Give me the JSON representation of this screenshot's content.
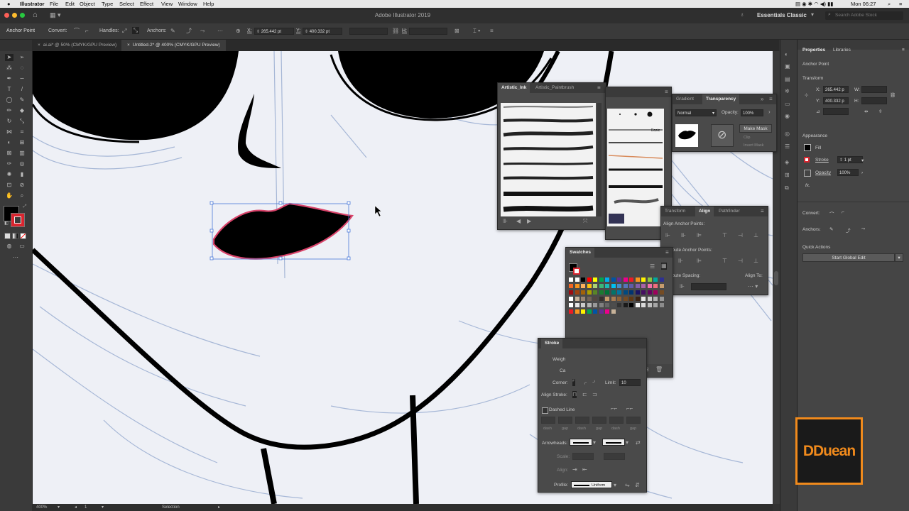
{
  "menubar": {
    "app": "Illustrator",
    "items": [
      "File",
      "Edit",
      "Object",
      "Type",
      "Select",
      "Effect",
      "View",
      "Window",
      "Help"
    ],
    "clock": "Mon 06:27"
  },
  "titlebar": {
    "title": "Adobe Illustrator 2019",
    "workspace": "Essentials Classic",
    "search_placeholder": "Search Adobe Stock"
  },
  "control": {
    "selection_label": "Anchor Point",
    "convert": "Convert:",
    "handles": "Handles:",
    "anchors": "Anchors:",
    "x_label": "X:",
    "x_value": "265.442 pt",
    "y_label": "Y:",
    "y_value": "400.332 pt",
    "w_label": "W:",
    "h_label": "H:"
  },
  "tabs": [
    {
      "label": "ai.ai* @ 50% (CMYK/GPU Preview)"
    },
    {
      "label": "Untitled-2* @ 400% (CMYK/GPU Preview)"
    }
  ],
  "status": {
    "zoom": "400%",
    "page": "1",
    "tool": "Selection"
  },
  "brushes_panel": {
    "tabs": [
      "Artistic_Ink",
      "Artistic_Paintbrush"
    ]
  },
  "basic_label": "Basic",
  "transparency_panel": {
    "tabs": [
      "Gradient",
      "Transparency"
    ],
    "mode": "Normal",
    "opacity_label": "Opacity:",
    "opacity_value": "100%",
    "make_mask": "Make Mask",
    "clip": "Clip",
    "invert_mask": "Invert Mask"
  },
  "align_panel": {
    "tabs": [
      "Transform",
      "Align",
      "Pathfinder"
    ],
    "align_anchor_points": "Align Anchor Points:",
    "distribute_anchor_points": "ibute Anchor Points:",
    "distribute_spacing": "ibute Spacing:",
    "align_to": "Align To:"
  },
  "swatches_panel": {
    "title": "Swatches"
  },
  "stroke_panel": {
    "title": "Stroke",
    "weight": "Weigh",
    "cap": "Ca",
    "corner": "Corner:",
    "limit_label": "Limit:",
    "limit_value": "10",
    "align_stroke": "Align Stroke:",
    "dashed_line": "Dashed Line",
    "dash_labels": [
      "dash",
      "gap",
      "dash",
      "gap",
      "dash",
      "gap"
    ],
    "arrowheads": "Arrowheads:",
    "scale": "Scale:",
    "align": "Align:",
    "profile": "Profile:",
    "profile_value": "Uniform"
  },
  "properties": {
    "tabs": [
      "Properties",
      "Libraries"
    ],
    "section": "Anchor Point",
    "transform": "Transform",
    "x_label": "X:",
    "x_value": "265.442 p",
    "y_label": "Y:",
    "y_value": "400.332 p",
    "w_label": "W:",
    "h_label": "H:",
    "appearance": "Appearance",
    "fill": "Fill",
    "stroke": "Stroke",
    "stroke_value": "1 pt",
    "opacity": "Opacity",
    "opacity_value": "100%",
    "fx": "fx.",
    "convert": "Convert:",
    "anchors": "Anchors:",
    "quick_actions": "Quick Actions",
    "start_global_edit": "Start Global Edit"
  },
  "brand": {
    "text": "DDuean"
  },
  "colors": {
    "accent_red": "#d9252f",
    "brand_orange": "#f08a1c"
  }
}
